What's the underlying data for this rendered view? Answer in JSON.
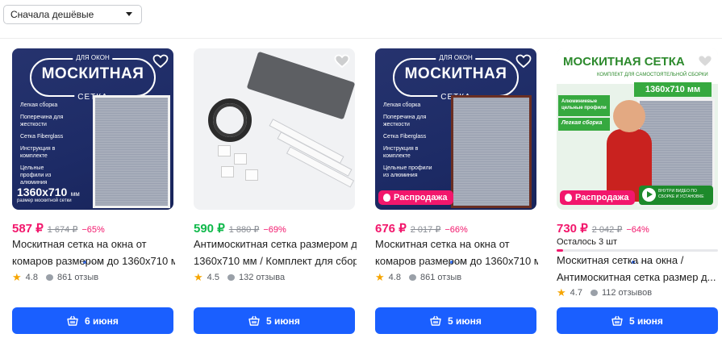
{
  "sort": {
    "selected": "Сначала дешёвые"
  },
  "products": [
    {
      "price": "587 ₽",
      "old_price": "1 674 ₽",
      "discount": "−65%",
      "title_line1": "Москитная сетка на окна от",
      "title_line2": "комаров размером до 1360х710 м...",
      "rating": "4.8",
      "reviews": "861 отзыв",
      "delivery": "6 июня",
      "image": {
        "banner_top": "ДЛЯ ОКОН",
        "banner_mid": "МОСКИТНАЯ",
        "banner_bot": "СЕТКА",
        "features": [
          "Легкая сборка",
          "Поперечина для жесткости",
          "Сетка Fiberglass",
          "Инструкция в комплекте",
          "Цельные профили из алюминия"
        ],
        "size": "1360х710",
        "size_unit": "мм",
        "size_caption": "размер москитной сетки"
      }
    },
    {
      "price": "590 ₽",
      "old_price": "1 880 ₽",
      "discount": "−69%",
      "title_line1": "Антимоскитная сетка размером до",
      "title_line2": "1360х710 мм / Комплект для сборки",
      "rating": "4.5",
      "reviews": "132 отзыва",
      "delivery": "5 июня"
    },
    {
      "price": "676 ₽",
      "old_price": "2 017 ₽",
      "discount": "−66%",
      "title_line1": "Москитная сетка на окна от",
      "title_line2": "комаров размером до 1360х710 м...",
      "rating": "4.8",
      "reviews": "861 отзыв",
      "delivery": "5 июня",
      "sale_label": "Распродажа",
      "image": {
        "banner_top": "ДЛЯ ОКОН",
        "banner_mid": "МОСКИТНАЯ",
        "banner_bot": "СЕТКА",
        "features": [
          "Легкая сборка",
          "Поперечина для жесткости",
          "Сетка Fiberglass",
          "Инструкция в комплекте",
          "Цельные профили из алюминия"
        ]
      }
    },
    {
      "price": "730 ₽",
      "old_price": "2 042 ₽",
      "discount": "−64%",
      "stock_left": "Осталось 3 шт",
      "stock_fraction": 0.04,
      "title_line1": "Москитная сетка на окна /",
      "title_line2": "Антимоскитная сетка размер д...",
      "rating": "4.7",
      "reviews": "112 отзывов",
      "delivery": "5 июня",
      "sale_label": "Распродажа",
      "image": {
        "heading": "МОСКИТНАЯ СЕТКА",
        "sub": "КОМПЛЕКТ ДЛЯ САМОСТОЯТЕЛЬНОЙ СБОРКИ",
        "size": "1360х710 мм",
        "badge1": "Алюминиевые цельные профили",
        "badge2": "Легкая сборка",
        "video_text": "ВНУТРИ ВИДЕО ПО СБОРКЕ И УСТАНОВКЕ"
      }
    }
  ],
  "colors": {
    "accent": "#1a5fff",
    "price_pink": "#f2176c",
    "price_green": "#10b94b",
    "star": "#f6a500"
  }
}
